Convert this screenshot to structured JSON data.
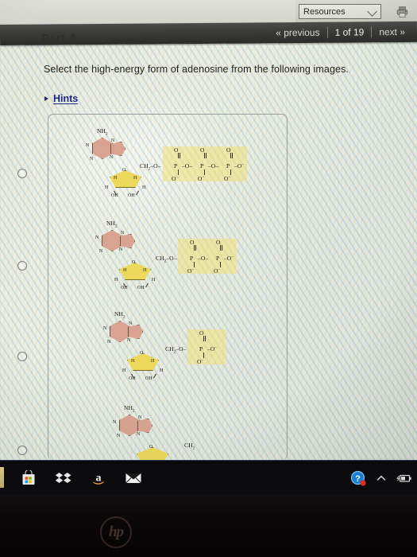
{
  "browser": {
    "resources_dropdown": {
      "label": "Resources",
      "icon": "chevron-down-icon"
    },
    "print_button": {
      "icon": "printer-icon",
      "title": "Print"
    }
  },
  "navigation": {
    "previous_label": "« previous",
    "position_label": "1 of 19",
    "next_label": "next »",
    "separator": "|"
  },
  "content": {
    "part_label": "Part A",
    "question_text": "Select the high-energy form of adenosine from the following images.",
    "hints_label": "Hints",
    "hints_icon": "triangle-right-icon"
  },
  "options": [
    {
      "id": "option-atp",
      "name": "adenosine-triphosphate",
      "selected": false,
      "base_label": "NH2",
      "ring_labels": [
        "N",
        "N",
        "N",
        "N"
      ],
      "sugar_labels": [
        "O",
        "H",
        "H",
        "H",
        "H",
        "OH",
        "OH"
      ],
      "chain_prefix": "CH2",
      "phosphate_count": 3,
      "phosphate_atoms": [
        "O",
        "P",
        "O-"
      ],
      "highlighted": true
    },
    {
      "id": "option-adp",
      "name": "adenosine-diphosphate",
      "selected": false,
      "base_label": "NH2",
      "ring_labels": [
        "N",
        "N",
        "N",
        "N"
      ],
      "sugar_labels": [
        "O",
        "H",
        "H",
        "H",
        "H",
        "OH",
        "OH"
      ],
      "chain_prefix": "CH2",
      "phosphate_count": 2,
      "phosphate_atoms": [
        "O",
        "P",
        "O-"
      ],
      "highlighted": true
    },
    {
      "id": "option-amp",
      "name": "adenosine-monophosphate",
      "selected": false,
      "base_label": "NH2",
      "ring_labels": [
        "N",
        "N",
        "N",
        "N"
      ],
      "sugar_labels": [
        "O",
        "H",
        "H",
        "H",
        "H",
        "OH",
        "OH"
      ],
      "chain_prefix": "CH2",
      "phosphate_count": 1,
      "phosphate_atoms": [
        "O",
        "P",
        "O-"
      ],
      "highlighted": true
    },
    {
      "id": "option-adenosine",
      "name": "adenosine",
      "selected": false,
      "base_label": "NH2",
      "ring_labels": [
        "N",
        "N",
        "N",
        "N"
      ],
      "sugar_labels": [
        "O"
      ],
      "chain_prefix": "CH2",
      "phosphate_count": 0,
      "phosphate_atoms": [],
      "highlighted": false
    }
  ],
  "chem_glyphs": {
    "oxygen": "O",
    "phosphorus": "P",
    "oxygen_anion": "O⁻",
    "hydrogen": "H",
    "hydroxyl": "OH",
    "nitrogen": "N",
    "amine": "NH",
    "amine_sub": "2",
    "methylene": "CH",
    "methylene_sub": "2"
  },
  "taskbar": {
    "items": [
      {
        "name": "microsoft-store-icon",
        "label": "Microsoft Store"
      },
      {
        "name": "dropbox-icon",
        "label": "Dropbox"
      },
      {
        "name": "amazon-icon",
        "label": "Amazon"
      },
      {
        "name": "mail-icon",
        "label": "Mail"
      }
    ],
    "tray": [
      {
        "name": "help-icon",
        "label": "?",
        "badge": true
      },
      {
        "name": "chevron-up-icon",
        "label": "Show hidden icons"
      },
      {
        "name": "battery-icon",
        "label": "Battery"
      }
    ]
  },
  "device": {
    "brand_logo": "hp"
  },
  "colors": {
    "link": "#1c2a86",
    "highlight": "#f0e278",
    "adenine_fill": "#d8a391",
    "ribose_fill": "#ecd95c",
    "navbar": "#3a3a38",
    "taskbar": "#0b0b0d"
  }
}
